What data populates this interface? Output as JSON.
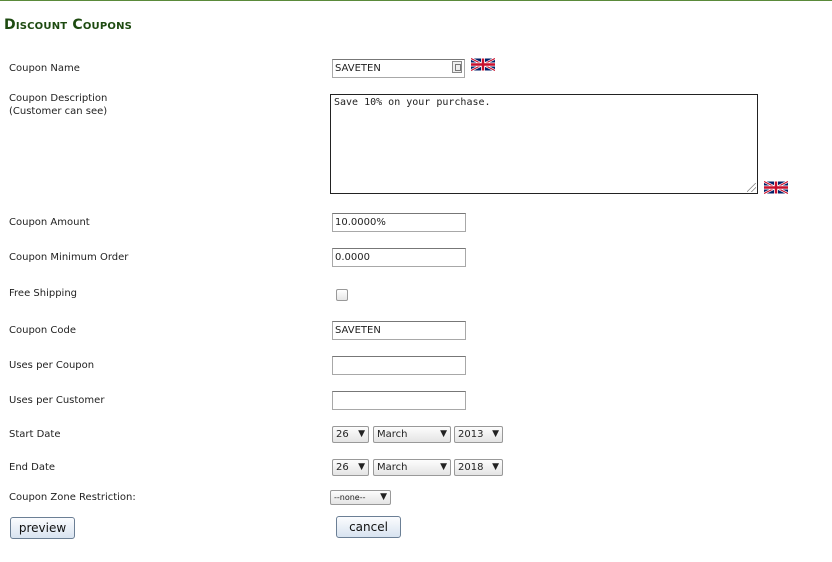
{
  "page": {
    "title": "Discount Coupons"
  },
  "form": {
    "coupon_name": {
      "label": "Coupon Name",
      "value": "SAVETEN"
    },
    "coupon_description": {
      "label_line1": "Coupon Description",
      "label_line2": "(Customer can see)",
      "value": "Save 10% on your purchase."
    },
    "coupon_amount": {
      "label": "Coupon Amount",
      "value": "10.0000%"
    },
    "minimum_order": {
      "label": "Coupon Minimum Order",
      "value": "0.0000"
    },
    "free_shipping": {
      "label": "Free Shipping",
      "checked": false
    },
    "coupon_code": {
      "label": "Coupon Code",
      "value": "SAVETEN"
    },
    "uses_per_coupon": {
      "label": "Uses per Coupon",
      "value": ""
    },
    "uses_per_customer": {
      "label": "Uses per Customer",
      "value": ""
    },
    "start_date": {
      "label": "Start Date",
      "day": "26",
      "month": "March",
      "year": "2013"
    },
    "end_date": {
      "label": "End Date",
      "day": "26",
      "month": "March",
      "year": "2018"
    },
    "zone_restriction": {
      "label": "Coupon Zone Restriction:",
      "value": "--none--"
    }
  },
  "buttons": {
    "preview": "preview",
    "cancel": "cancel"
  },
  "icons": {
    "language_flag": "uk-flag-icon",
    "dropdown": "chevron-down-icon"
  },
  "colors": {
    "title": "#1d4a10",
    "top_border": "#5a8a3a"
  }
}
